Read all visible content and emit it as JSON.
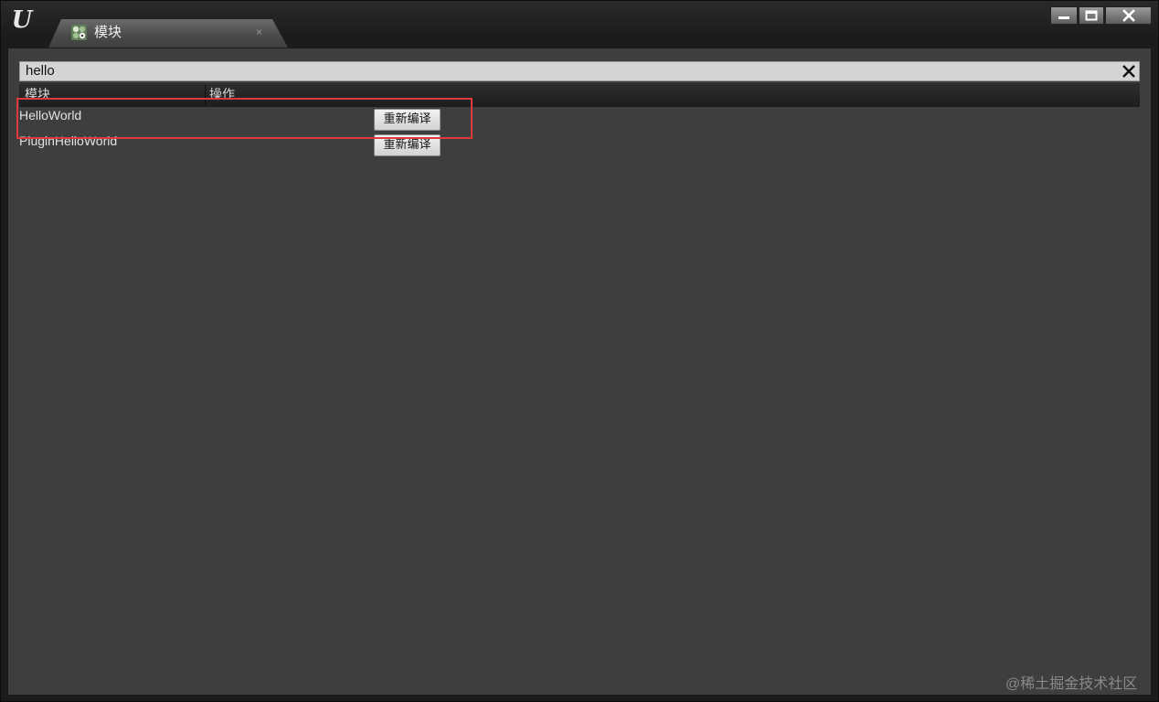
{
  "window": {
    "logo_text": "U",
    "minimize_icon": "minimize-icon",
    "maximize_icon": "maximize-icon",
    "close_icon": "close-icon"
  },
  "tab": {
    "label": "模块",
    "icon": "modules-icon",
    "close_symbol": "×"
  },
  "search": {
    "value": "hello",
    "clear_icon": "clear-icon"
  },
  "table": {
    "columns": [
      "模块",
      "操作"
    ],
    "rows": [
      {
        "module": "HelloWorld",
        "action_label": "重新编译"
      },
      {
        "module": "PluginHelloWorld",
        "action_label": "重新编译"
      }
    ]
  },
  "annotation": {
    "highlight_color": "#e0393c"
  },
  "watermark": "@稀土掘金技术社区"
}
